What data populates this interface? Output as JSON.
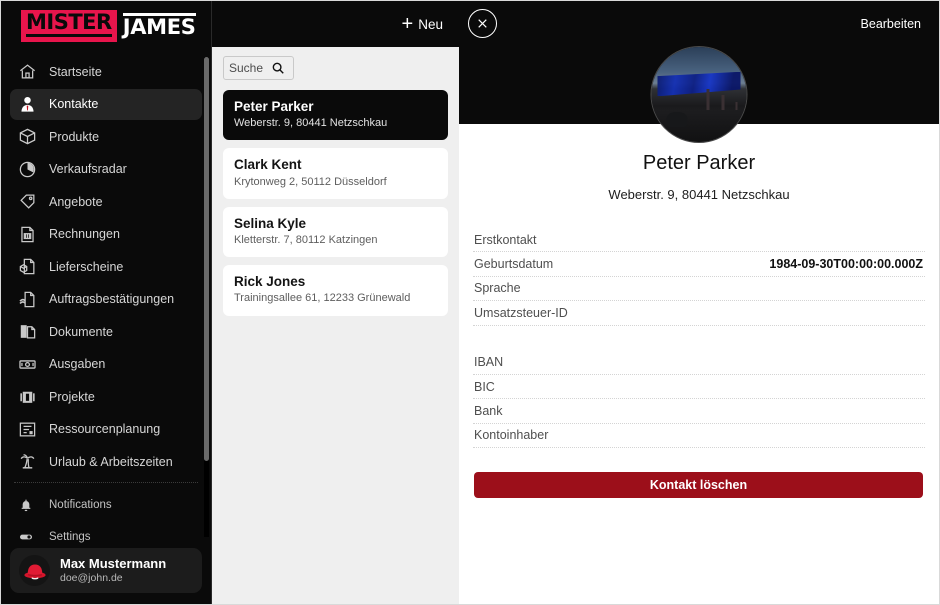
{
  "brand": {
    "word1": "MISTER",
    "word2": "JAMES",
    "accent_color": "#e8154c"
  },
  "sidebar": {
    "items": [
      {
        "label": "Startseite",
        "icon": "home-icon",
        "active": false
      },
      {
        "label": "Kontakte",
        "icon": "contact-person-icon",
        "active": true
      },
      {
        "label": "Produkte",
        "icon": "box-icon",
        "active": false
      },
      {
        "label": "Verkaufsradar",
        "icon": "pie-chart-icon",
        "active": false
      },
      {
        "label": "Angebote",
        "icon": "tag-icon",
        "active": false
      },
      {
        "label": "Rechnungen",
        "icon": "invoice-icon",
        "active": false
      },
      {
        "label": "Lieferscheine",
        "icon": "delivery-note-icon",
        "active": false
      },
      {
        "label": "Auftragsbestätigungen",
        "icon": "order-confirmation-icon",
        "active": false
      },
      {
        "label": "Dokumente",
        "icon": "documents-icon",
        "active": false
      },
      {
        "label": "Ausgaben",
        "icon": "banknote-icon",
        "active": false
      },
      {
        "label": "Projekte",
        "icon": "briefcase-icon",
        "active": false
      },
      {
        "label": "Ressourcenplanung",
        "icon": "resource-plan-icon",
        "active": false
      },
      {
        "label": "Urlaub & Arbeitszeiten",
        "icon": "palm-tree-icon",
        "active": false
      }
    ],
    "secondary": [
      {
        "label": "Notifications",
        "icon": "bell-icon"
      },
      {
        "label": "Settings",
        "icon": "toggle-icon"
      }
    ],
    "user": {
      "name": "Max Mustermann",
      "email": "doe@john.de",
      "avatar": "red-hat-avatar"
    }
  },
  "list": {
    "new_button": {
      "label": "Neu",
      "icon": "plus-icon"
    },
    "search": {
      "placeholder": "Suche",
      "value": "",
      "icon": "search-icon"
    },
    "contacts": [
      {
        "name": "Peter Parker",
        "address": "Weberstr. 9, 80441 Netzschkau",
        "selected": true
      },
      {
        "name": "Clark Kent",
        "address": "Krytonweg 2, 50112 Düsseldorf",
        "selected": false
      },
      {
        "name": "Selina Kyle",
        "address": "Kletterstr. 7, 80112 Katzingen",
        "selected": false
      },
      {
        "name": "Rick Jones",
        "address": "Trainingsallee 61, 12233 Grünewald",
        "selected": false
      }
    ]
  },
  "detail": {
    "close_icon": "close-circle-icon",
    "edit_label": "Bearbeiten",
    "photo": "contact-photo",
    "name": "Peter Parker",
    "address": "Weberstr. 9, 80441 Netzschkau",
    "fields_group1": [
      {
        "label": "Erstkontakt",
        "value": ""
      },
      {
        "label": "Geburtsdatum",
        "value": "1984-09-30T00:00:00.000Z"
      },
      {
        "label": "Sprache",
        "value": ""
      },
      {
        "label": "Umsatzsteuer-ID",
        "value": ""
      }
    ],
    "fields_group2": [
      {
        "label": "IBAN",
        "value": ""
      },
      {
        "label": "BIC",
        "value": ""
      },
      {
        "label": "Bank",
        "value": ""
      },
      {
        "label": "Kontoinhaber",
        "value": ""
      }
    ],
    "delete_label": "Kontakt löschen",
    "delete_color": "#9c0f1a"
  }
}
